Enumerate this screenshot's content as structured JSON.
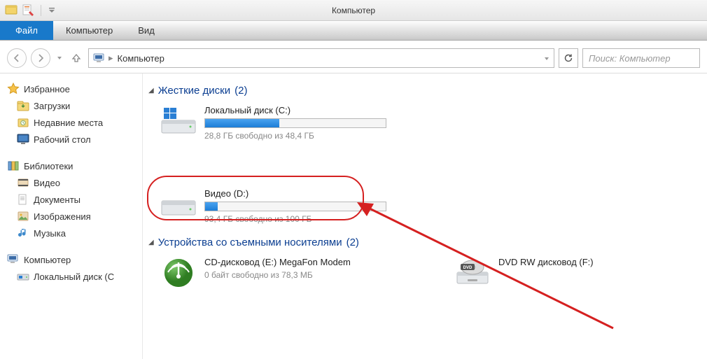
{
  "titlebar": {
    "title": "Компьютер"
  },
  "menu": {
    "file": "Файл",
    "computer": "Компьютер",
    "view": "Вид"
  },
  "nav": {
    "breadcrumb": "Компьютер",
    "search_placeholder": "Поиск: Компьютер"
  },
  "sidebar": {
    "favorites": {
      "label": "Избранное",
      "items": [
        {
          "label": "Загрузки",
          "icon": "downloads"
        },
        {
          "label": "Недавние места",
          "icon": "recent"
        },
        {
          "label": "Рабочий стол",
          "icon": "desktop"
        }
      ]
    },
    "libraries": {
      "label": "Библиотеки",
      "items": [
        {
          "label": "Видео",
          "icon": "video"
        },
        {
          "label": "Документы",
          "icon": "documents"
        },
        {
          "label": "Изображения",
          "icon": "pictures"
        },
        {
          "label": "Музыка",
          "icon": "music"
        }
      ]
    },
    "computer": {
      "label": "Компьютер",
      "items": [
        {
          "label": "Локальный диск (C",
          "icon": "localdisk"
        }
      ]
    }
  },
  "content": {
    "group_hdd": {
      "label": "Жесткие диски",
      "count": "(2)"
    },
    "group_removable": {
      "label": "Устройства со съемными носителями",
      "count": "(2)"
    },
    "drives": {
      "c": {
        "name": "Локальный диск (C:)",
        "sub": "28,8 ГБ свободно из 48,4 ГБ",
        "fill_pct": 41,
        "icon": "win_hdd"
      },
      "d": {
        "name": "Видео (D:)",
        "sub": "93,4 ГБ свободно из 100 ГБ",
        "fill_pct": 7,
        "icon": "hdd"
      },
      "e": {
        "name": "CD-дисковод (E:) MegaFon Modem",
        "sub": "0 байт свободно из 78,3 МБ",
        "icon": "megafon"
      },
      "f": {
        "name": "DVD RW дисковод (F:)",
        "icon": "dvd"
      }
    }
  },
  "annotations": {
    "arrow_color": "#d52020"
  }
}
